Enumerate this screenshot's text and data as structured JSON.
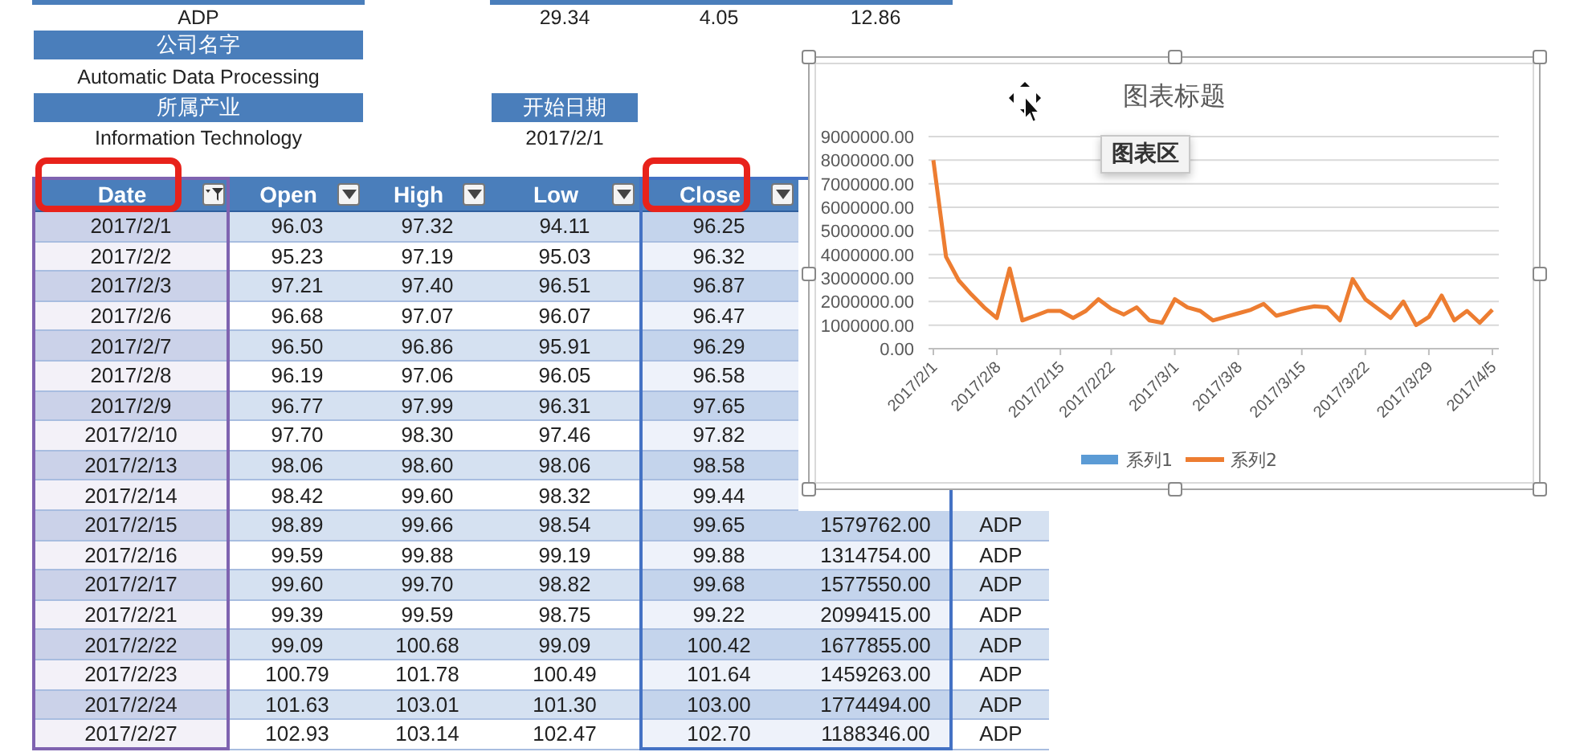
{
  "summary": {
    "symbol": "ADP",
    "values": [
      "29.34",
      "4.05",
      "12.86"
    ],
    "company_label": "公司名字",
    "company": "Automatic Data Processing",
    "industry_label": "所属产业",
    "industry": "Information Technology",
    "start_label": "开始日期",
    "start_date": "2017/2/1"
  },
  "columns": [
    {
      "label": "Date",
      "filtered": true,
      "highlighted": true,
      "color": "#7f63b0"
    },
    {
      "label": "Open",
      "filtered": false,
      "highlighted": false
    },
    {
      "label": "High",
      "filtered": false,
      "highlighted": false
    },
    {
      "label": "Low",
      "filtered": false,
      "highlighted": false
    },
    {
      "label": "Close",
      "filtered": false,
      "highlighted": true,
      "color": "#4472c4"
    },
    {
      "color": "#4472c4"
    },
    {}
  ],
  "rows": [
    {
      "cells": [
        "2017/2/1",
        "96.03",
        "97.32",
        "94.11",
        "96.25"
      ]
    },
    {
      "cells": [
        "2017/2/2",
        "95.23",
        "97.19",
        "95.03",
        "96.32"
      ]
    },
    {
      "cells": [
        "2017/2/3",
        "97.21",
        "97.40",
        "96.51",
        "96.87"
      ]
    },
    {
      "cells": [
        "2017/2/6",
        "96.68",
        "97.07",
        "96.07",
        "96.47"
      ]
    },
    {
      "cells": [
        "2017/2/7",
        "96.50",
        "96.86",
        "95.91",
        "96.29"
      ]
    },
    {
      "cells": [
        "2017/2/8",
        "96.19",
        "97.06",
        "96.05",
        "96.58"
      ]
    },
    {
      "cells": [
        "2017/2/9",
        "96.77",
        "97.99",
        "96.31",
        "97.65"
      ]
    },
    {
      "cells": [
        "2017/2/10",
        "97.70",
        "98.30",
        "97.46",
        "97.82"
      ]
    },
    {
      "cells": [
        "2017/2/13",
        "98.06",
        "98.60",
        "98.06",
        "98.58"
      ]
    },
    {
      "cells": [
        "2017/2/14",
        "98.42",
        "99.60",
        "98.32",
        "99.44"
      ]
    },
    {
      "cells": [
        "2017/2/15",
        "98.89",
        "99.66",
        "98.54",
        "99.65",
        "1579762.00",
        "ADP"
      ]
    },
    {
      "cells": [
        "2017/2/16",
        "99.59",
        "99.88",
        "99.19",
        "99.88",
        "1314754.00",
        "ADP"
      ]
    },
    {
      "cells": [
        "2017/2/17",
        "99.60",
        "99.70",
        "98.82",
        "99.68",
        "1577550.00",
        "ADP"
      ]
    },
    {
      "cells": [
        "2017/2/21",
        "99.39",
        "99.59",
        "98.75",
        "99.22",
        "2099415.00",
        "ADP"
      ]
    },
    {
      "cells": [
        "2017/2/22",
        "99.09",
        "100.68",
        "99.09",
        "100.42",
        "1677855.00",
        "ADP"
      ]
    },
    {
      "cells": [
        "2017/2/23",
        "100.79",
        "101.78",
        "100.49",
        "101.64",
        "1459263.00",
        "ADP"
      ]
    },
    {
      "cells": [
        "2017/2/24",
        "101.63",
        "103.01",
        "101.30",
        "103.00",
        "1774494.00",
        "ADP"
      ]
    },
    {
      "cells": [
        "2017/2/27",
        "102.93",
        "103.14",
        "102.47",
        "102.70",
        "1188346.00",
        "ADP"
      ]
    }
  ],
  "chart": {
    "title": "图表标题",
    "tooltip": "图表区",
    "chart_data": {
      "type": "line",
      "categories": [
        "2017/2/1",
        null,
        null,
        null,
        null,
        "2017/2/8",
        null,
        null,
        null,
        null,
        "2017/2/15",
        null,
        null,
        null,
        "2017/2/22",
        null,
        null,
        null,
        null,
        "2017/3/1",
        null,
        null,
        null,
        null,
        "2017/3/8",
        null,
        null,
        null,
        null,
        "2017/3/15",
        null,
        null,
        null,
        null,
        "2017/3/22",
        null,
        null,
        null,
        null,
        "2017/3/29",
        null,
        null,
        null,
        null,
        "2017/4/5"
      ],
      "series": [
        {
          "name": "系列1",
          "color": "#5b9bd5",
          "values": [
            null,
            null,
            null,
            null,
            null,
            null,
            null,
            null,
            null,
            null,
            null,
            null,
            null,
            null,
            null,
            null,
            null,
            null,
            null,
            null,
            null,
            null,
            null,
            null,
            null,
            null,
            null,
            null,
            null,
            null,
            null,
            null,
            null,
            null,
            null,
            null,
            null,
            null,
            null,
            null,
            null,
            null,
            null,
            null,
            null
          ]
        },
        {
          "name": "系列2",
          "color": "#ed7d31",
          "values": [
            8000000,
            3900000,
            2900000,
            2300000,
            1750000,
            1300000,
            3400000,
            1200000,
            1400000,
            1600000,
            1600000,
            1300000,
            1600000,
            2100000,
            1700000,
            1450000,
            1750000,
            1200000,
            1100000,
            2100000,
            1750000,
            1600000,
            1200000,
            1350000,
            1500000,
            1650000,
            1900000,
            1400000,
            1550000,
            1700000,
            1800000,
            1750000,
            1200000,
            2950000,
            2100000,
            1700000,
            1300000,
            2000000,
            1000000,
            1350000,
            2250000,
            1200000,
            1600000,
            1100000,
            1650000
          ]
        }
      ],
      "ylim": [
        0,
        9000000
      ],
      "grid": true,
      "yticks": [
        {
          "value": 0,
          "label": "0.00"
        },
        {
          "value": 1000000,
          "label": "1000000.00"
        },
        {
          "value": 2000000,
          "label": "2000000.00"
        },
        {
          "value": 3000000,
          "label": "3000000.00"
        },
        {
          "value": 4000000,
          "label": "4000000.00"
        },
        {
          "value": 5000000,
          "label": "5000000.00"
        },
        {
          "value": 6000000,
          "label": "6000000.00"
        },
        {
          "value": 7000000,
          "label": "7000000.00"
        },
        {
          "value": 8000000,
          "label": "8000000.00"
        },
        {
          "value": 9000000,
          "label": "9000000.00"
        }
      ]
    }
  }
}
